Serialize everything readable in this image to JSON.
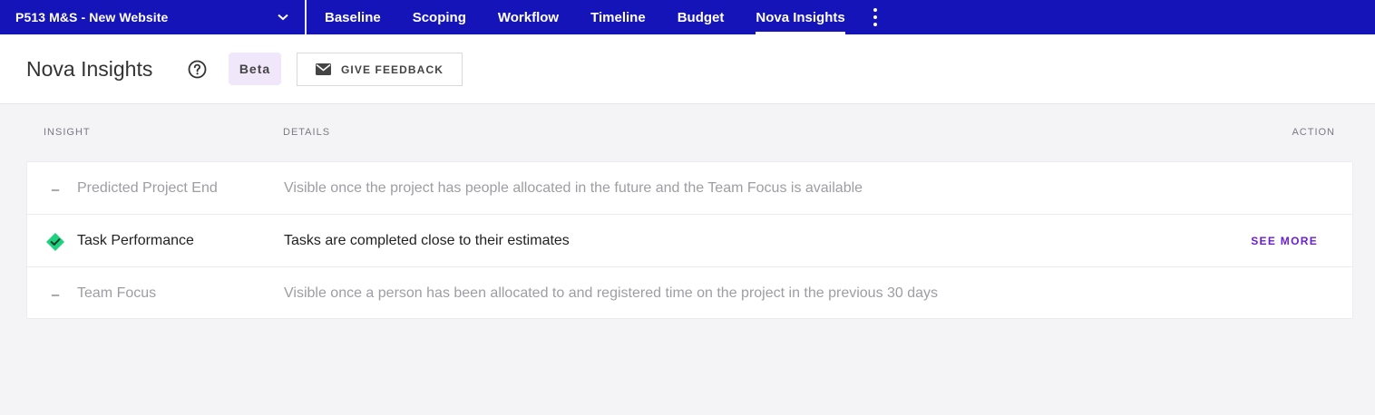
{
  "topbar": {
    "project": "P513 M&S - New Website",
    "tabs": [
      {
        "label": "Baseline",
        "active": false
      },
      {
        "label": "Scoping",
        "active": false
      },
      {
        "label": "Workflow",
        "active": false
      },
      {
        "label": "Timeline",
        "active": false
      },
      {
        "label": "Budget",
        "active": false
      },
      {
        "label": "Nova Insights",
        "active": true
      }
    ]
  },
  "header": {
    "title": "Nova Insights",
    "badge": "Beta",
    "feedback_label": "GIVE FEEDBACK"
  },
  "table": {
    "columns": {
      "insight": "INSIGHT",
      "details": "DETAILS",
      "action": "ACTION"
    },
    "rows": [
      {
        "status": "–",
        "name": "Predicted Project End",
        "details": "Visible once the project has people allocated in the future and the Team Focus is available",
        "action": ""
      },
      {
        "status": "check-diamond-icon",
        "name": "Task Performance",
        "details": "Tasks are completed close to their estimates",
        "action": "SEE MORE"
      },
      {
        "status": "–",
        "name": "Team Focus",
        "details": "Visible once a person has been allocated to and registered time on the project in the previous 30 days",
        "action": ""
      }
    ]
  },
  "colors": {
    "topbar": "#1414b8",
    "success": "#1fd17e",
    "accent": "#6a1ed0"
  }
}
